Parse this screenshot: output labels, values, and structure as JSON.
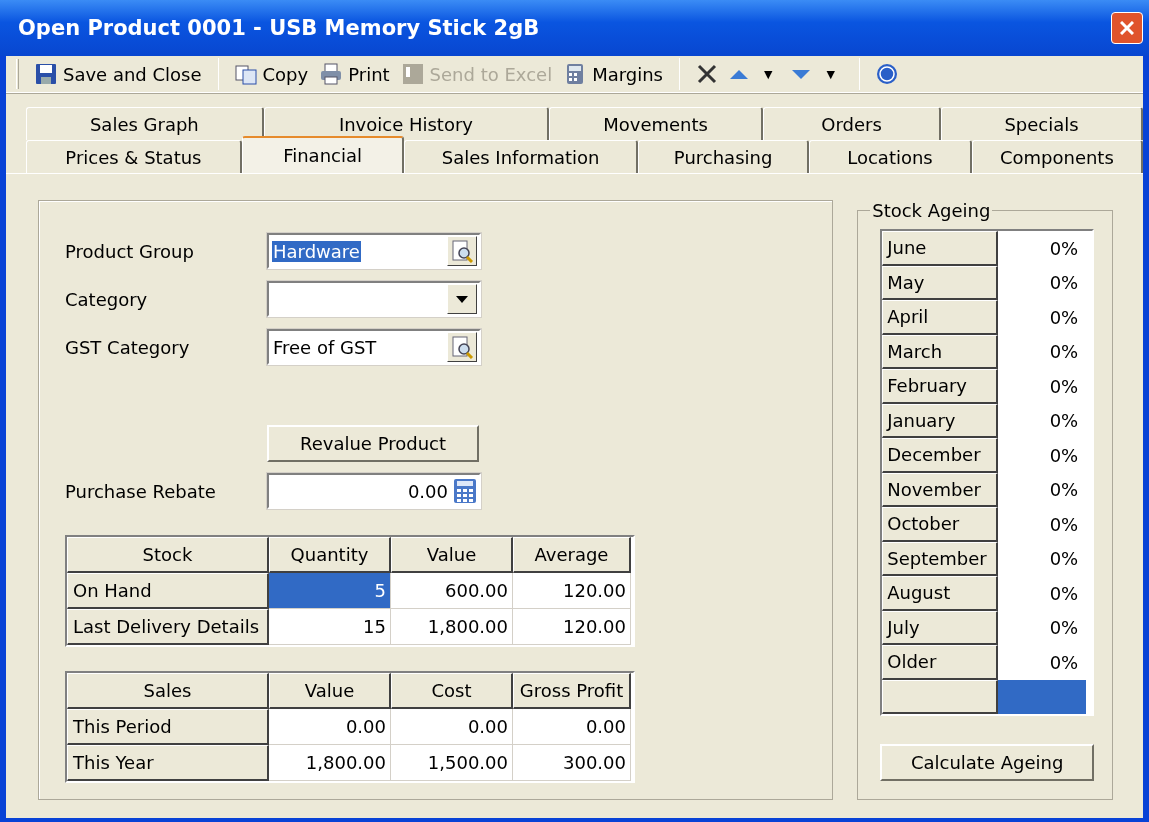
{
  "window": {
    "title": "Open Product 0001 - USB Memory Stick 2gB"
  },
  "toolbar": {
    "groups": [
      [
        {
          "kind": "save",
          "label": "Save and Close",
          "disabled": false
        }
      ],
      [
        {
          "kind": "copy",
          "label": "Copy",
          "disabled": false
        },
        {
          "kind": "print",
          "label": "Print",
          "disabled": false
        },
        {
          "kind": "excel",
          "label": "Send to Excel",
          "disabled": true
        },
        {
          "kind": "margins",
          "label": "Margins",
          "disabled": false
        }
      ],
      [
        {
          "kind": "delete"
        },
        {
          "kind": "up",
          "menu_arrow": "▼"
        },
        {
          "kind": "down",
          "menu_arrow": "▼"
        }
      ],
      [
        {
          "kind": "help"
        }
      ]
    ]
  },
  "tabs": {
    "back_row": [
      {
        "label": "Sales Graph",
        "selected": false
      },
      {
        "label": "Invoice History",
        "selected": false
      },
      {
        "label": "Movements",
        "selected": false
      },
      {
        "label": "Orders",
        "selected": false
      },
      {
        "label": "Specials",
        "selected": false
      }
    ],
    "front_row": [
      {
        "label": "Prices & Status",
        "selected": false
      },
      {
        "label": "Financial",
        "selected": true
      },
      {
        "label": "Sales Information",
        "selected": false
      },
      {
        "label": "Purchasing",
        "selected": false
      },
      {
        "label": "Locations",
        "selected": false
      },
      {
        "label": "Components",
        "selected": false
      }
    ]
  },
  "form": {
    "fields": [
      {
        "kind": "lookup",
        "label": "Product Group",
        "value": "Hardware",
        "selected": true
      },
      {
        "kind": "dropdown",
        "label": "Category"
      },
      {
        "kind": "lookup",
        "label": "GST Category",
        "value": "Free of GST",
        "selected": false
      }
    ],
    "revalue_button": "Revalue Product",
    "rebate": {
      "label": "Purchase Rebate",
      "value": "0.00"
    }
  },
  "stock_table": {
    "columns": [
      "Stock",
      "Quantity",
      "Value",
      "Average"
    ],
    "rows": [
      {
        "cells": [
          {
            "text": "On Hand",
            "selected": false
          },
          {
            "text": "5",
            "selected": true
          },
          {
            "text": "600.00",
            "selected": false
          },
          {
            "text": "120.00",
            "selected": false
          }
        ]
      },
      {
        "cells": [
          {
            "text": "Last Delivery Details",
            "selected": false
          },
          {
            "text": "15",
            "selected": false
          },
          {
            "text": "1,800.00",
            "selected": false
          },
          {
            "text": "120.00",
            "selected": false
          }
        ]
      }
    ]
  },
  "sales_table": {
    "columns": [
      "Sales",
      "Value",
      "Cost",
      "Gross Profit"
    ],
    "rows": [
      {
        "cells": [
          {
            "text": "This Period",
            "selected": false
          },
          {
            "text": "0.00",
            "selected": false
          },
          {
            "text": "0.00",
            "selected": false
          },
          {
            "text": "0.00",
            "selected": false
          }
        ]
      },
      {
        "cells": [
          {
            "text": "This Year",
            "selected": false
          },
          {
            "text": "1,800.00",
            "selected": false
          },
          {
            "text": "1,500.00",
            "selected": false
          },
          {
            "text": "300.00",
            "selected": false
          }
        ]
      }
    ]
  },
  "stock_ageing": {
    "title": "Stock Ageing",
    "rows": [
      {
        "month": "June",
        "percent": "0%",
        "selected": false
      },
      {
        "month": "May",
        "percent": "0%",
        "selected": false
      },
      {
        "month": "April",
        "percent": "0%",
        "selected": false
      },
      {
        "month": "March",
        "percent": "0%",
        "selected": false
      },
      {
        "month": "February",
        "percent": "0%",
        "selected": false
      },
      {
        "month": "January",
        "percent": "0%",
        "selected": false
      },
      {
        "month": "December",
        "percent": "0%",
        "selected": false
      },
      {
        "month": "November",
        "percent": "0%",
        "selected": false
      },
      {
        "month": "October",
        "percent": "0%",
        "selected": false
      },
      {
        "month": "September",
        "percent": "0%",
        "selected": false
      },
      {
        "month": "August",
        "percent": "0%",
        "selected": false
      },
      {
        "month": "July",
        "percent": "0%",
        "selected": false
      },
      {
        "month": "Older",
        "percent": "0%",
        "selected": false
      },
      {
        "selected": true
      }
    ],
    "button": "Calculate Ageing"
  }
}
